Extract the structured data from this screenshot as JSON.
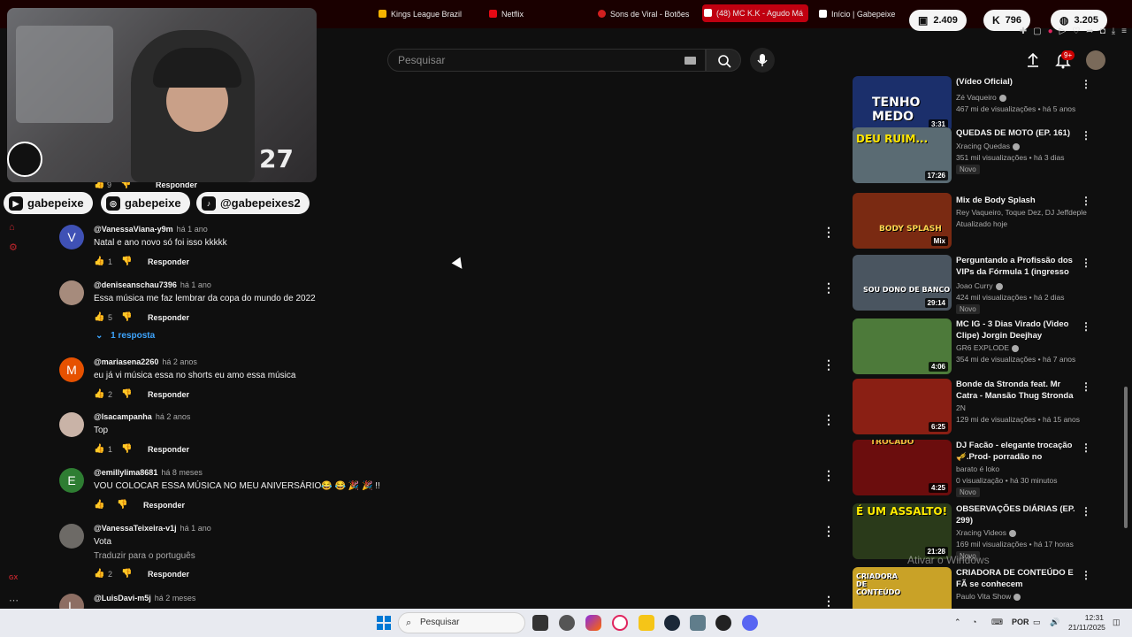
{
  "browser_tabs": [
    {
      "label": "Kings League Brazil",
      "color": "#f5b400"
    },
    {
      "label": "Netflix",
      "color": "#e50914"
    },
    {
      "label": "Sons de Viral - Botões",
      "color": "#d21f1f"
    },
    {
      "label": "(48) MC K.K - Agudo Má",
      "color": "#ff0000",
      "active": true
    },
    {
      "label": "Início | Gabepeixe",
      "color": "#ffffff"
    }
  ],
  "counters": [
    {
      "icon": "chat-icon",
      "value": "2.409"
    },
    {
      "icon": "kick-icon",
      "value": "796"
    },
    {
      "icon": "globe-icon",
      "value": "3.205"
    }
  ],
  "header": {
    "search_placeholder": "Pesquisar",
    "notification_badge": "9+"
  },
  "webcam": {
    "overlay_number": "27"
  },
  "socials": [
    {
      "platform": "youtube-icon",
      "handle": "gabepeixe"
    },
    {
      "platform": "instagram-icon",
      "handle": "gabepeixe"
    },
    {
      "platform": "tiktok-icon",
      "handle": "@gabepeixes2"
    }
  ],
  "partial_comment": {
    "likes": "9",
    "reply_label": "Responder"
  },
  "comments": [
    {
      "avatar_letter": "V",
      "avatar_color": "#3f51b5",
      "author": "@VanessaViana-y9m",
      "time": "há 1 ano",
      "lines": [
        "Natal e ano novo só foi isso kkkkk"
      ],
      "likes": "1",
      "reply_label": "Responder"
    },
    {
      "avatar_letter": "",
      "avatar_color": "#a68b7c",
      "author": "@deniseanschau7396",
      "time": "há 1 ano",
      "lines": [
        "Essa música me faz lembrar da copa do mundo de 2022"
      ],
      "likes": "5",
      "reply_label": "Responder",
      "replies_label": "1 resposta"
    },
    {
      "avatar_letter": "M",
      "avatar_color": "#e65100",
      "author": "@mariasena2260",
      "time": "há 2 anos",
      "lines": [
        "eu já vi música essa no shorts eu amo essa música"
      ],
      "likes": "2",
      "reply_label": "Responder"
    },
    {
      "avatar_letter": "",
      "avatar_color": "#c9b3a7",
      "author": "@lsacampanha",
      "time": "há 2 anos",
      "lines": [
        "Top"
      ],
      "likes": "1",
      "reply_label": "Responder"
    },
    {
      "avatar_letter": "E",
      "avatar_color": "#2e7d32",
      "author": "@emillylima8681",
      "time": "há 8 meses",
      "lines": [
        "VOU COLOCAR ESSA MÚSICA NO MEU ANIVERSÁRIO😂 😂 🎉 🎉 !!"
      ],
      "likes": "",
      "reply_label": "Responder"
    },
    {
      "avatar_letter": "",
      "avatar_color": "#6d6a66",
      "author": "@VanessaTeixeira-v1j",
      "time": "há 1 ano",
      "lines": [
        "Vota"
      ],
      "translate_label": "Traduzir para o português",
      "likes": "2",
      "reply_label": "Responder"
    },
    {
      "avatar_letter": "L",
      "avatar_color": "#8d6e63",
      "author": "@LuisDavi-m5j",
      "time": "há 2 meses",
      "lines": [],
      "likes": "",
      "reply_label": ""
    }
  ],
  "videos": [
    {
      "thumb_text": "TENHO MEDO",
      "thumb_color": "#1b2f6b",
      "duration": "3:31",
      "title": "(Vídeo Oficial)",
      "channel": "Zé Vaqueiro",
      "verified": true,
      "meta": "467 mi de visualizações • há 5 anos",
      "badge": ""
    },
    {
      "thumb_text": "DEU RUIM...",
      "thumb_color": "#5a6b73",
      "duration": "17:26",
      "title": "QUEDAS DE MOTO (EP. 161)",
      "channel": "Xracing Quedas",
      "verified": true,
      "meta": "351 mil visualizações • há 3 dias",
      "badge": "Novo"
    },
    {
      "thumb_text": "BODY SPLASH",
      "thumb_color": "#7a2a12",
      "duration": "Mix",
      "title": "Mix de Body Splash",
      "channel": "Rey Vaqueiro, Toque Dez, DJ Jeffdeple o...",
      "verified": false,
      "meta": "Atualizado hoje",
      "badge": ""
    },
    {
      "thumb_text": "SOU DONO DE BANCO",
      "thumb_color": "#4a5560",
      "duration": "29:14",
      "title": "Perguntando a Profissão dos VIPs da Fórmula 1 (ingresso de...",
      "channel": "Joao Curry",
      "verified": true,
      "meta": "424 mil visualizações • há 2 dias",
      "badge": "Novo"
    },
    {
      "thumb_text": "",
      "thumb_color": "#4d7a3a",
      "duration": "4:06",
      "title": "MC IG  - 3 Dias Virado (Video Clipe) Jorgin Deejhay",
      "channel": "GR6 EXPLODE",
      "verified": true,
      "meta": "354 mi de visualizações • há 7 anos",
      "badge": ""
    },
    {
      "thumb_text": "",
      "thumb_color": "#8a1f14",
      "duration": "6:25",
      "title": "Bonde da Stronda feat. Mr Catra - Mansão Thug Stronda  ...",
      "channel": "2N",
      "verified": false,
      "meta": "129 mi de visualizações • há 15 anos",
      "badge": ""
    },
    {
      "thumb_text": "TROCADO",
      "thumb_color": "#6b0d0d",
      "duration": "4:25",
      "title": "DJ Facão - elegante trocação 🎺.Prod- porradão no corredo...",
      "channel": "barato é loko",
      "verified": false,
      "meta": "0 visualização • há 30 minutos",
      "badge": "Novo"
    },
    {
      "thumb_text": "É UM ASSALTO!",
      "thumb_color": "#2a3a1a",
      "duration": "21:28",
      "title": "OBSERVAÇÕES DIÁRIAS (EP. 299)",
      "channel": "Xracing Videos",
      "verified": true,
      "meta": "169 mil visualizações • há 17 horas",
      "badge": "Novo"
    },
    {
      "thumb_text": "CRIADORA DE CONTEÚDO",
      "thumb_color": "#c9a227",
      "duration": "",
      "title": "CRIADORA DE CONTEÚDO E FÃ se conhecem PESSOALMENTE",
      "channel": "Paulo Vita Show",
      "verified": true,
      "meta": "",
      "badge": ""
    }
  ],
  "watermark": "Ativar o Windows",
  "taskbar": {
    "search_placeholder": "Pesquisar",
    "language": "POR",
    "time": "12:31",
    "date": "21/11/2025"
  },
  "left_bottom_label": "GX"
}
